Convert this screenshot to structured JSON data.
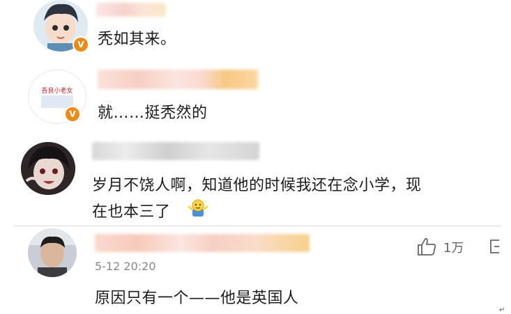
{
  "comments": [
    {
      "text": "秃如其来。"
    },
    {
      "avatar_text": "吾良小老女",
      "text": "就……挺秃然的"
    },
    {
      "text_line1": "岁月不饶人啊，知道他的时候我还在念小学，现",
      "text_line2": "在也本三了"
    },
    {
      "time": "5-12 20:20",
      "likes": "1万",
      "text": "原因只有一个——他是英国人"
    }
  ],
  "badge": {
    "label": "V",
    "color": "#ea8b1a"
  },
  "icons": [
    "thumbs-up-icon",
    "shrug-emoji-icon",
    "more-icon"
  ]
}
